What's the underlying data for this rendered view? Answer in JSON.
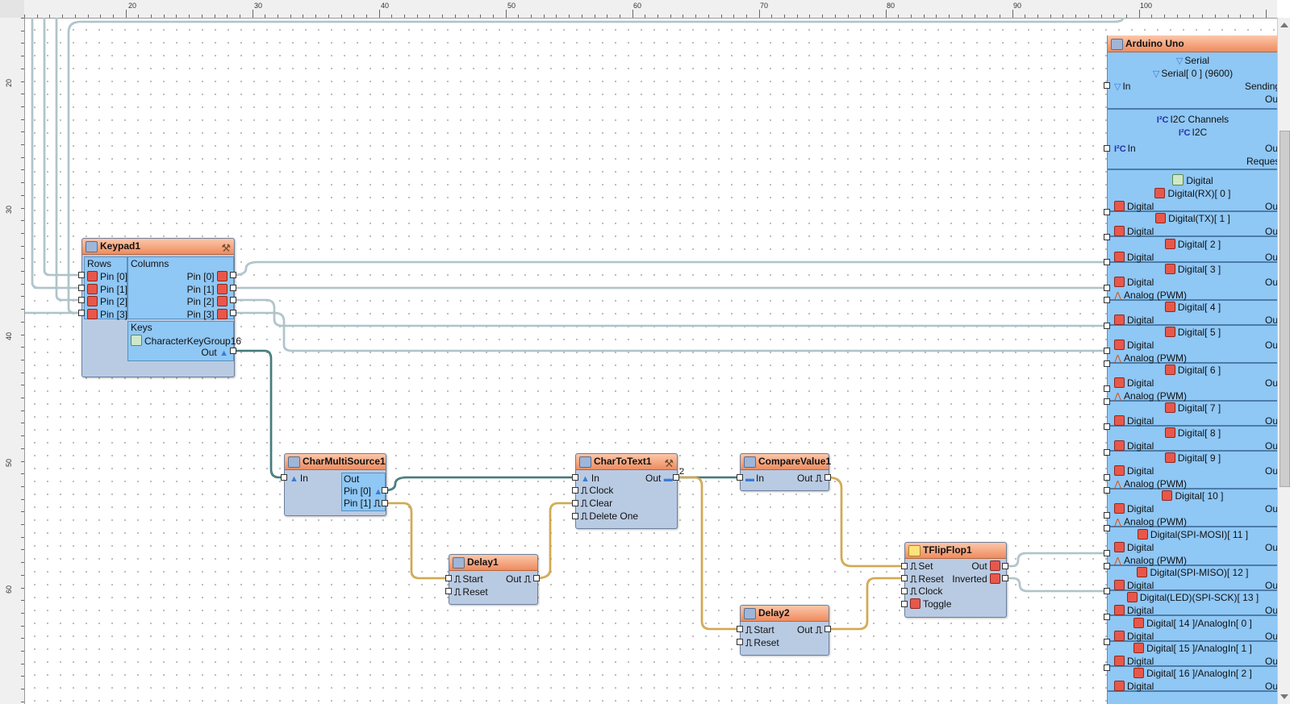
{
  "ruler": {
    "top_labels": [
      "20",
      "30",
      "40",
      "50",
      "60",
      "70",
      "80",
      "90",
      "100"
    ],
    "left_labels": [
      "20",
      "30",
      "40",
      "50",
      "60"
    ]
  },
  "keypad": {
    "title": "Keypad1",
    "rows_label": "Rows",
    "columns_label": "Columns",
    "row_pins": [
      "Pin [0]",
      "Pin [1]",
      "Pin [2]",
      "Pin [3]"
    ],
    "col_pins": [
      "Pin [0]",
      "Pin [1]",
      "Pin [2]",
      "Pin [3]"
    ],
    "keys_label": "Keys",
    "key_group": "CharacterKeyGroup16",
    "out_label": "Out"
  },
  "charmulti": {
    "title": "CharMultiSource1",
    "in_label": "In",
    "out_label": "Out",
    "pin0": "Pin [0]",
    "pin1": "Pin [1]"
  },
  "chartotext": {
    "title": "CharToText1",
    "in_label": "In",
    "clock_label": "Clock",
    "clear_label": "Clear",
    "delete_label": "Delete One",
    "out_label": "Out",
    "out_count": "2"
  },
  "compare": {
    "title": "CompareValue1",
    "in_label": "In",
    "out_label": "Out"
  },
  "delay1": {
    "title": "Delay1",
    "start_label": "Start",
    "reset_label": "Reset",
    "out_label": "Out"
  },
  "delay2": {
    "title": "Delay2",
    "start_label": "Start",
    "reset_label": "Reset",
    "out_label": "Out"
  },
  "tflip": {
    "title": "TFlipFlop1",
    "set_label": "Set",
    "reset_label": "Reset",
    "clock_label": "Clock",
    "toggle_label": "Toggle",
    "out_label": "Out",
    "inverted_label": "Inverted"
  },
  "arduino": {
    "title": "Arduino Uno",
    "serial_group": "Serial",
    "serial_item": "Serial[ 0 ] (9600)",
    "serial_in": "In",
    "serial_sending": "Sending",
    "serial_out": "Out",
    "i2c_group": "I2C Channels",
    "i2c_item": "I2C",
    "i2c_in": "In",
    "i2c_out": "Out",
    "i2c_request": "Request",
    "digital_group": "Digital",
    "digital_label": "Digital",
    "analog_label": "Analog (PWM)",
    "out_label": "Out",
    "channels": [
      {
        "name": "Digital(RX)[ 0 ]",
        "analog": false
      },
      {
        "name": "Digital(TX)[ 1 ]",
        "analog": false
      },
      {
        "name": "Digital[ 2 ]",
        "analog": false
      },
      {
        "name": "Digital[ 3 ]",
        "analog": true
      },
      {
        "name": "Digital[ 4 ]",
        "analog": false
      },
      {
        "name": "Digital[ 5 ]",
        "analog": true
      },
      {
        "name": "Digital[ 6 ]",
        "analog": true
      },
      {
        "name": "Digital[ 7 ]",
        "analog": false
      },
      {
        "name": "Digital[ 8 ]",
        "analog": false
      },
      {
        "name": "Digital[ 9 ]",
        "analog": true
      },
      {
        "name": "Digital[ 10 ]",
        "analog": true
      },
      {
        "name": "Digital(SPI-MOSI)[ 11 ]",
        "analog": true
      },
      {
        "name": "Digital(SPI-MISO)[ 12 ]",
        "analog": false
      },
      {
        "name": "Digital(LED)(SPI-SCK)[ 13 ]",
        "analog": false
      },
      {
        "name": "Digital[ 14 ]/AnalogIn[ 0 ]",
        "analog": false
      },
      {
        "name": "Digital[ 15 ]/AnalogIn[ 1 ]",
        "analog": false
      },
      {
        "name": "Digital[ 16 ]/AnalogIn[ 2 ]",
        "analog": false
      }
    ]
  },
  "colors": {
    "wire_gray": "#9fb7bf",
    "wire_teal": "#1e5f5f",
    "wire_gold": "#c7962e"
  }
}
